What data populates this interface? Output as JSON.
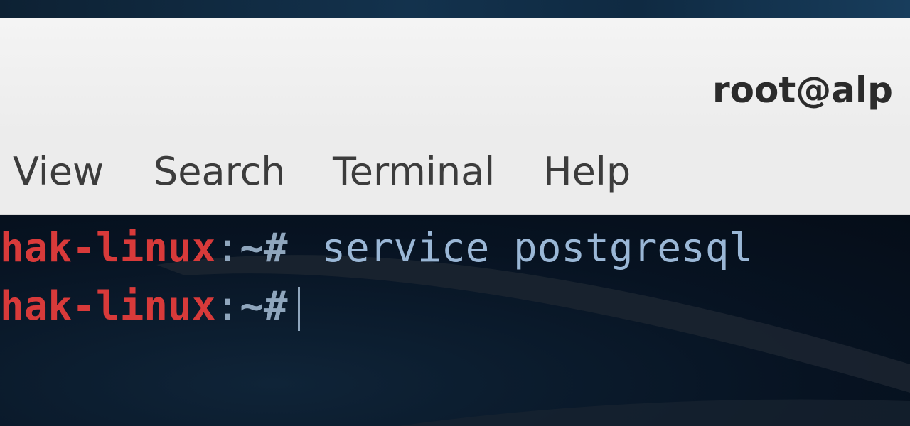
{
  "window": {
    "title": "root@alp"
  },
  "menubar": {
    "items": [
      {
        "label": "View"
      },
      {
        "label": "Search"
      },
      {
        "label": "Terminal"
      },
      {
        "label": "Help"
      }
    ]
  },
  "terminal": {
    "lines": [
      {
        "host": "hak-linux",
        "separator": ":",
        "path": "~#",
        "command": "service postgresql"
      },
      {
        "host": "hak-linux",
        "separator": ":",
        "path": "~#",
        "command": ""
      }
    ],
    "colors": {
      "host": "#d83a3a",
      "prompt": "#8fa6bd",
      "command": "#9ab7d6",
      "background": "#071322"
    }
  }
}
